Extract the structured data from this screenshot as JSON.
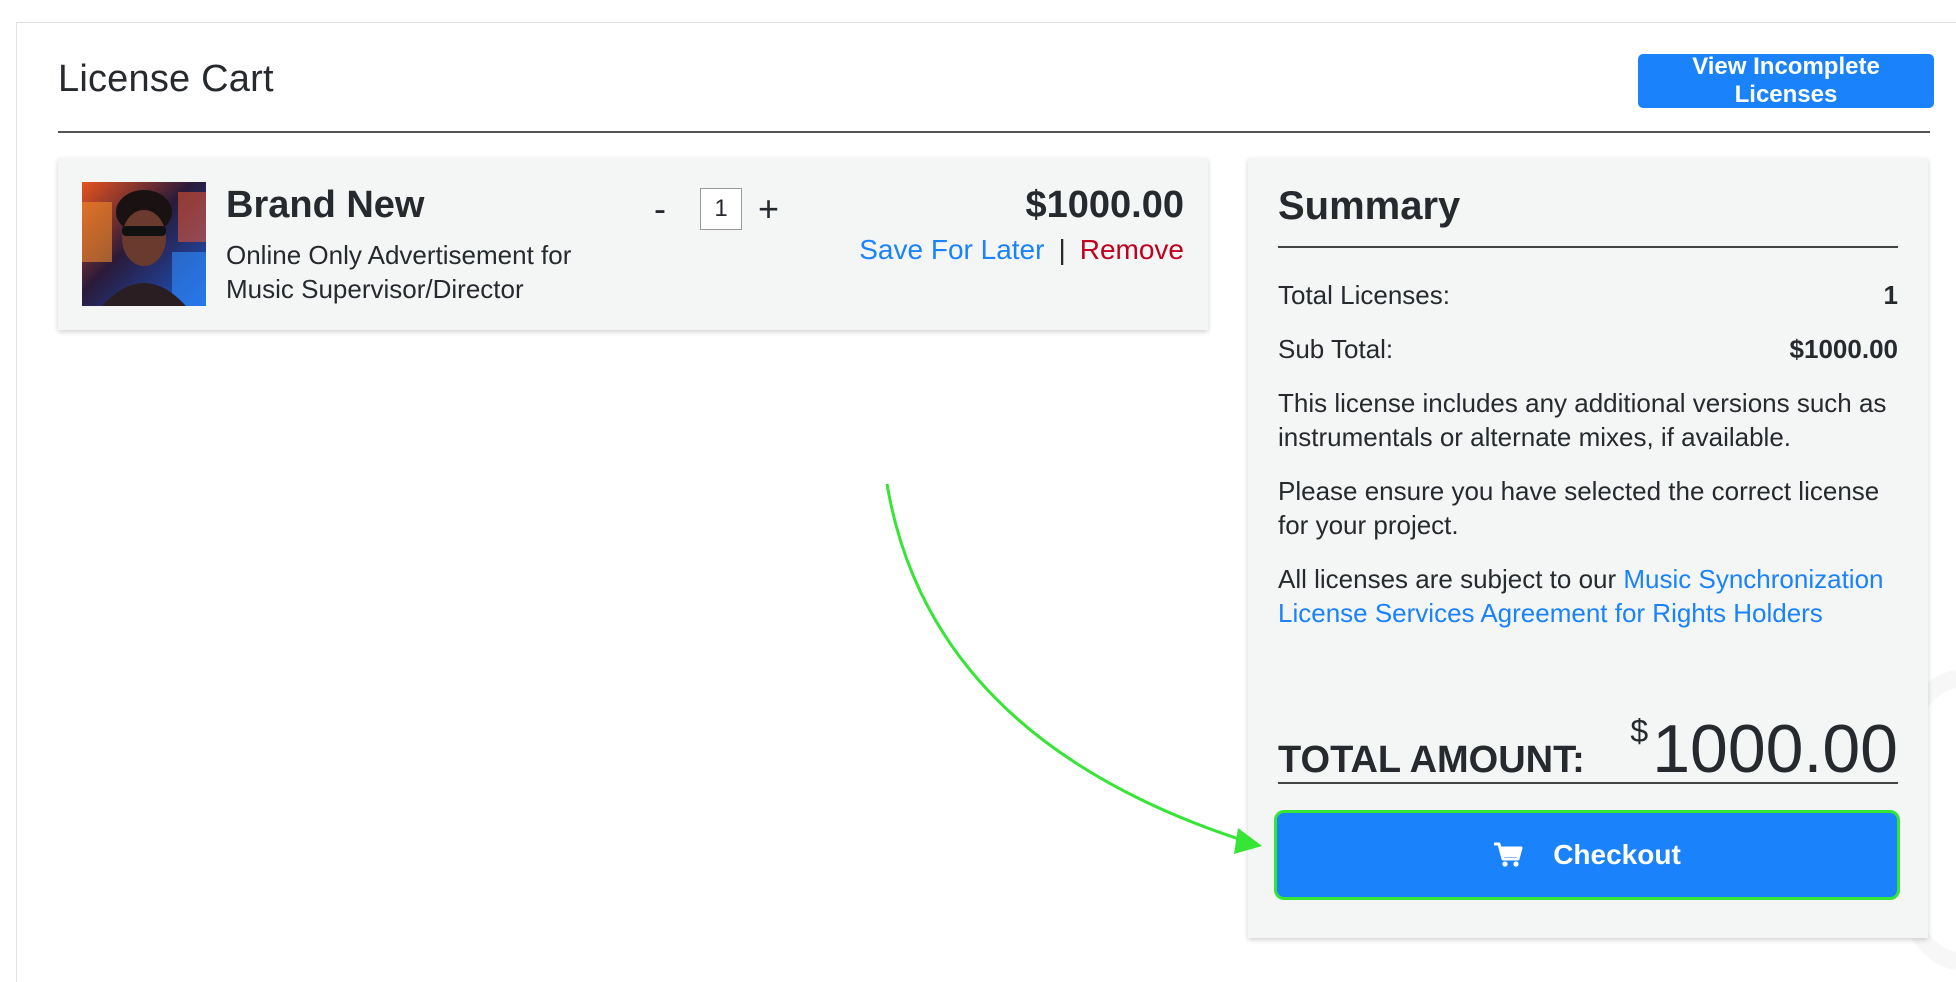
{
  "header": {
    "title": "License Cart",
    "incomplete_button": "View Incomplete Licenses"
  },
  "cart_item": {
    "title": "Brand New",
    "license_type": "Online Only Advertisement for Music Supervisor/Director",
    "quantity": "1",
    "minus": "-",
    "plus": "+",
    "price": "$1000.00",
    "save_for_later": "Save For Later",
    "separator": "|",
    "remove": "Remove"
  },
  "summary": {
    "title": "Summary",
    "total_licenses_label": "Total Licenses:",
    "total_licenses_value": "1",
    "subtotal_label": "Sub Total:",
    "subtotal_value": "$1000.00",
    "note_versions": "This license includes any additional versions such as instrumentals or alternate mixes, if available.",
    "note_ensure": "Please ensure you have selected the correct license for your project.",
    "note_subject_prefix": "All licenses are subject to our ",
    "agreement_link": "Music Synchronization License Services Agreement for Rights Holders",
    "total_label": "TOTAL AMOUNT:",
    "total_currency": "$",
    "total_value": "1000.00",
    "checkout_label": "Checkout"
  },
  "icons": {
    "cart": "shopping-cart-icon",
    "thumbnail": "album-art"
  },
  "colors": {
    "primary": "#1a82fb",
    "remove": "#c0001f",
    "annotation": "#37e537"
  }
}
